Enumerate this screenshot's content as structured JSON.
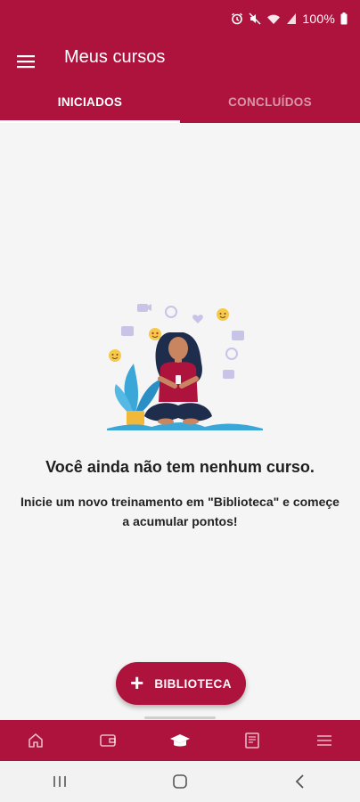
{
  "status_bar": {
    "battery_text": "100%",
    "icons": [
      "alarm-icon",
      "mute-icon",
      "wifi-icon",
      "signal-icon",
      "battery-icon"
    ]
  },
  "app_bar": {
    "title": "Meus cursos",
    "menu_icon": "hamburger-menu-icon"
  },
  "tabs": [
    {
      "label": "INICIADOS",
      "active": true
    },
    {
      "label": "CONCLUÍDOS",
      "active": false
    }
  ],
  "empty_state": {
    "title": "Você ainda não tem nenhum curso.",
    "subtitle": "Inicie um novo treinamento em \"Biblioteca\" e começe a acumular pontos!"
  },
  "fab": {
    "icon": "plus-icon",
    "label": "BIBLIOTECA"
  },
  "bottom_nav": [
    {
      "icon": "home-icon",
      "active": false
    },
    {
      "icon": "wallet-icon",
      "active": false
    },
    {
      "icon": "graduation-cap-icon",
      "active": true
    },
    {
      "icon": "book-icon",
      "active": false
    },
    {
      "icon": "menu-icon",
      "active": false
    }
  ],
  "system_nav": [
    "recent-apps-icon",
    "home-button-icon",
    "back-icon"
  ],
  "colors": {
    "primary": "#ad133d",
    "background": "#f5f5f5",
    "text_dark": "#1e1e1e"
  }
}
